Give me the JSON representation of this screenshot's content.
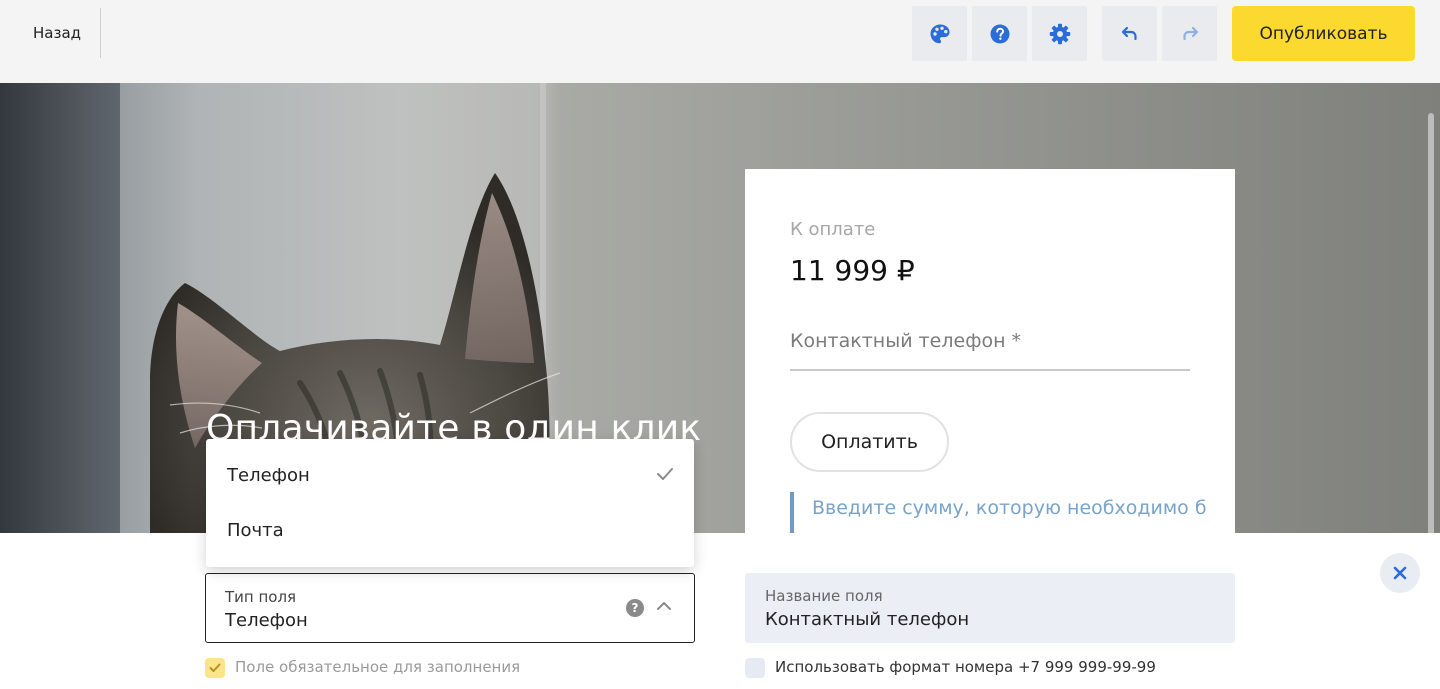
{
  "topbar": {
    "back_label": "Назад",
    "publish_label": "Опубликовать",
    "icons": [
      "palette-icon",
      "help-icon",
      "settings-icon",
      "undo-icon",
      "redo-icon"
    ],
    "publish_color": "#fbd92f"
  },
  "hero": {
    "title": "Оплачивайте в один клик"
  },
  "payment_card": {
    "amount_label": "К оплате",
    "amount": "11 999 ₽",
    "phone_placeholder": "Контактный телефон *",
    "pay_button": "Оплатить",
    "hint": "Введите сумму, которую необходимо б"
  },
  "dropdown": {
    "options": [
      {
        "label": "Телефон",
        "selected": true
      },
      {
        "label": "Почта",
        "selected": false
      }
    ]
  },
  "settings": {
    "field_type_label": "Тип поля",
    "field_type_value": "Телефон",
    "field_name_label": "Название поля",
    "field_name_value": "Контактный телефон",
    "required_label": "Поле обязательное для заполнения",
    "required_checked": true,
    "format_label": "Использовать формат номера +7 999 999-99-99",
    "format_checked": false
  },
  "colors": {
    "accent_blue": "#2a6cd8",
    "publish_yellow": "#fbd92f",
    "hint_blue": "#7aa3c9"
  }
}
